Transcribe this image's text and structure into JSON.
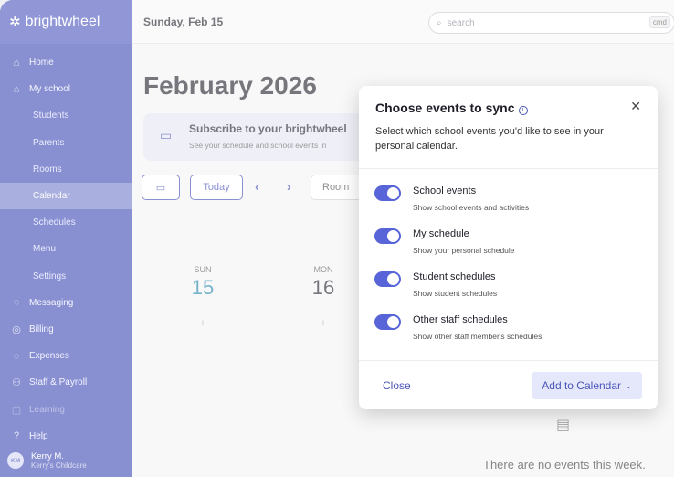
{
  "app": {
    "brand": "brightwheel"
  },
  "sidebar": {
    "items": [
      {
        "label": "Home",
        "icon": "home-icon",
        "type": "main"
      },
      {
        "label": "My school",
        "icon": "school-icon",
        "type": "main"
      },
      {
        "label": "Students",
        "type": "sub"
      },
      {
        "label": "Parents",
        "type": "sub"
      },
      {
        "label": "Rooms",
        "type": "sub"
      },
      {
        "label": "Calendar",
        "type": "sub",
        "active": true
      },
      {
        "label": "Schedules",
        "type": "sub"
      },
      {
        "label": "Menu",
        "type": "sub"
      },
      {
        "label": "Settings",
        "type": "sub"
      },
      {
        "label": "Messaging",
        "icon": "message-icon",
        "type": "main"
      },
      {
        "label": "Billing",
        "icon": "billing-icon",
        "type": "main"
      },
      {
        "label": "Expenses",
        "icon": "expenses-icon",
        "type": "main"
      },
      {
        "label": "Staff & Payroll",
        "icon": "staff-icon",
        "type": "main"
      },
      {
        "label": "Learning",
        "icon": "learning-icon",
        "type": "main",
        "faded": true
      },
      {
        "label": "Help",
        "icon": "help-icon",
        "type": "main"
      }
    ],
    "user": {
      "initials": "KM",
      "name": "Kerry M.",
      "org": "Kerry's Childcare"
    }
  },
  "header": {
    "date": "Sunday, Feb 15",
    "search_placeholder": "search",
    "search_shortcut": "cmd"
  },
  "main": {
    "title": "February 2026",
    "banner": {
      "title": "Subscribe to your brightwheel",
      "subtitle": "See your schedule and school events in"
    },
    "today_label": "Today",
    "room_label": "Room",
    "days": [
      {
        "name": "SUN",
        "date": "15",
        "highlight": true
      },
      {
        "name": "MON",
        "date": "16",
        "highlight": false
      }
    ],
    "empty_text": "There are no events this week."
  },
  "modal": {
    "title": "Choose events to sync",
    "description": "Select which school events you'd like to see in your personal calendar.",
    "options": [
      {
        "label": "School events",
        "desc": "Show school events and activities",
        "enabled": true
      },
      {
        "label": "My schedule",
        "desc": "Show your personal schedule",
        "enabled": true
      },
      {
        "label": "Student schedules",
        "desc": "Show student schedules",
        "enabled": true
      },
      {
        "label": "Other staff schedules",
        "desc": "Show other staff member's schedules",
        "enabled": true
      }
    ],
    "close_label": "Close",
    "add_label": "Add to Calendar"
  },
  "colors": {
    "accent": "#4b55b8",
    "toggle_on": "#5865d8",
    "sidebar_bg": "#4b55b8",
    "active_item": "#7c84cc"
  }
}
